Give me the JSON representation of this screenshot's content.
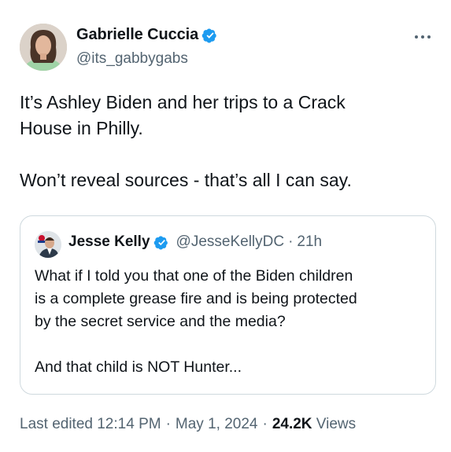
{
  "author": {
    "display_name": "Gabrielle Cuccia",
    "handle": "@its_gabbygabs"
  },
  "more_icon": "more-horizontal-icon",
  "tweet": {
    "line1": "It’s Ashley Biden and her trips to a Crack",
    "line2": "House in Philly.",
    "line3": "Won’t reveal sources - that’s all I can say."
  },
  "quote": {
    "display_name": "Jesse Kelly",
    "handle": "@JesseKellyDC",
    "separator": "·",
    "time": "21h",
    "line1": "What if I told you that one of the Biden children",
    "line2": "is a complete grease fire and is being protected",
    "line3": "by the secret service and the media?",
    "line4": "And that child is NOT Hunter..."
  },
  "meta": {
    "edited_label": "Last edited 12:14 PM",
    "separator": "·",
    "date": "May 1, 2024",
    "views_count": "24.2K",
    "views_label": "Views"
  },
  "colors": {
    "verified": "#1d9bf0",
    "secondary_text": "#536471",
    "border": "#cfd9de"
  }
}
